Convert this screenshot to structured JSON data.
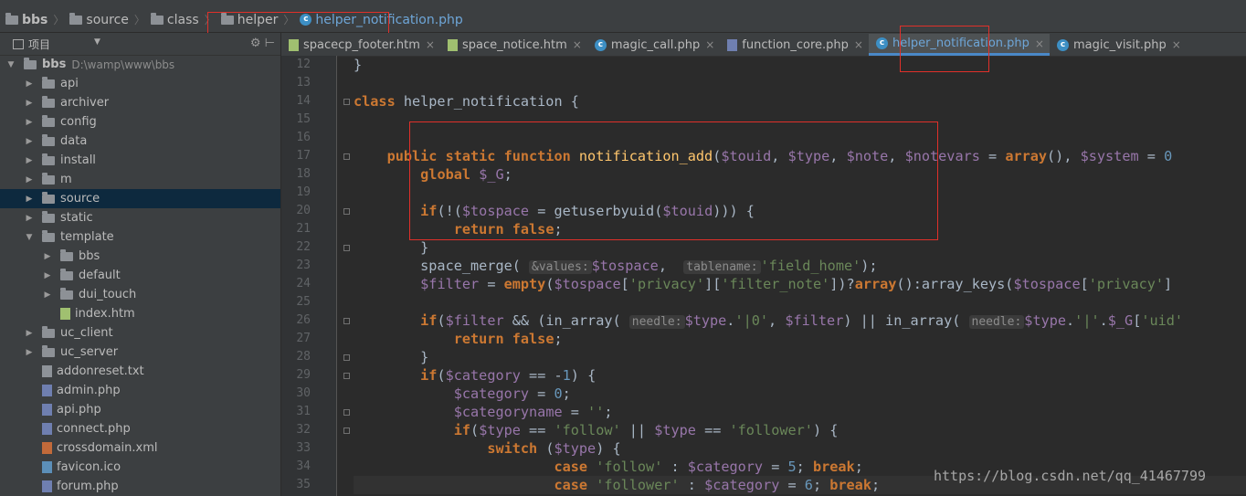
{
  "breadcrumb": {
    "items": [
      "bbs",
      "source",
      "class",
      "helper",
      "helper_notification.php"
    ]
  },
  "sidebar": {
    "header_label": "项目",
    "tree": [
      {
        "label": "bbs",
        "extra": "D:\\wamp\\www\\bbs",
        "kind": "folder",
        "arrow": "down"
      },
      {
        "label": "api",
        "kind": "folder",
        "arrow": "right"
      },
      {
        "label": "archiver",
        "kind": "folder",
        "arrow": "right"
      },
      {
        "label": "config",
        "kind": "folder",
        "arrow": "right"
      },
      {
        "label": "data",
        "kind": "folder",
        "arrow": "right"
      },
      {
        "label": "install",
        "kind": "folder",
        "arrow": "right"
      },
      {
        "label": "m",
        "kind": "folder",
        "arrow": "right"
      },
      {
        "label": "source",
        "kind": "folder",
        "arrow": "right",
        "selected": true
      },
      {
        "label": "static",
        "kind": "folder",
        "arrow": "right"
      },
      {
        "label": "template",
        "kind": "folder",
        "arrow": "down"
      },
      {
        "label": "bbs",
        "kind": "folder",
        "arrow": "right"
      },
      {
        "label": "default",
        "kind": "folder",
        "arrow": "right"
      },
      {
        "label": "dui_touch",
        "kind": "folder",
        "arrow": "right"
      },
      {
        "label": "index.htm",
        "kind": "html"
      },
      {
        "label": "uc_client",
        "kind": "folder",
        "arrow": "right"
      },
      {
        "label": "uc_server",
        "kind": "folder",
        "arrow": "right"
      },
      {
        "label": "addonreset.txt",
        "kind": "txt"
      },
      {
        "label": "admin.php",
        "kind": "php"
      },
      {
        "label": "api.php",
        "kind": "php"
      },
      {
        "label": "connect.php",
        "kind": "php"
      },
      {
        "label": "crossdomain.xml",
        "kind": "xml"
      },
      {
        "label": "favicon.ico",
        "kind": "ico"
      },
      {
        "label": "forum.php",
        "kind": "php"
      }
    ]
  },
  "tabs": [
    {
      "label": "spacecp_footer.htm",
      "kind": "html"
    },
    {
      "label": "space_notice.htm",
      "kind": "html"
    },
    {
      "label": "magic_call.php",
      "kind": "class"
    },
    {
      "label": "function_core.php",
      "kind": "php"
    },
    {
      "label": "helper_notification.php",
      "kind": "class",
      "active": true
    },
    {
      "label": "magic_visit.php",
      "kind": "class"
    }
  ],
  "editor": {
    "line_numbers": [
      "12",
      "13",
      "14",
      "15",
      "16",
      "17",
      "18",
      "19",
      "20",
      "21",
      "22",
      "23",
      "24",
      "25",
      "26",
      "27",
      "28",
      "29",
      "30",
      "31",
      "32",
      "33",
      "34",
      "35"
    ],
    "hints": {
      "values": "&values:",
      "tablename": "tablename:",
      "needle": "needle:"
    }
  },
  "watermark": "https://blog.csdn.net/qq_41467799"
}
